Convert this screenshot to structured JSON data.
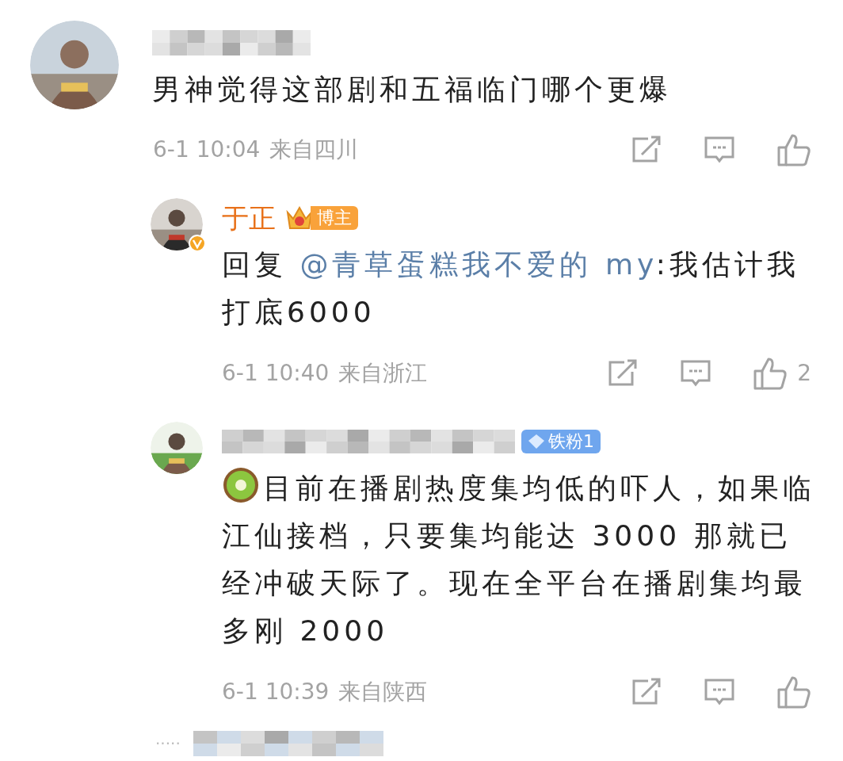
{
  "comment": {
    "text": "男神觉得这部剧和五福临门哪个更爆",
    "time": "6-1 10:04",
    "location": "来自四川"
  },
  "replies": [
    {
      "author": "于正",
      "verified": true,
      "badge": {
        "kind": "blogger",
        "label": "博主"
      },
      "emoji": false,
      "segments": [
        {
          "kind": "plain",
          "text": "回复 "
        },
        {
          "kind": "mention",
          "text": "@青草蛋糕我不爱的 my"
        },
        {
          "kind": "plain",
          "text": ":我估计我打底6000"
        }
      ],
      "time": "6-1 10:40",
      "location": "来自浙江",
      "likes": "2"
    },
    {
      "verified": false,
      "badge": {
        "kind": "fan",
        "label": "铁粉1"
      },
      "emoji": true,
      "segments": [
        {
          "kind": "plain",
          "text": "目前在播剧热度集均低的吓人，如果临江仙接档，只要集均能达 3000 那就已经冲破天际了。现在全平台在播剧集均最多刚 2000"
        }
      ],
      "time": "6-1 10:39",
      "location": "来自陕西"
    }
  ],
  "footer": {
    "dots": "·····"
  }
}
